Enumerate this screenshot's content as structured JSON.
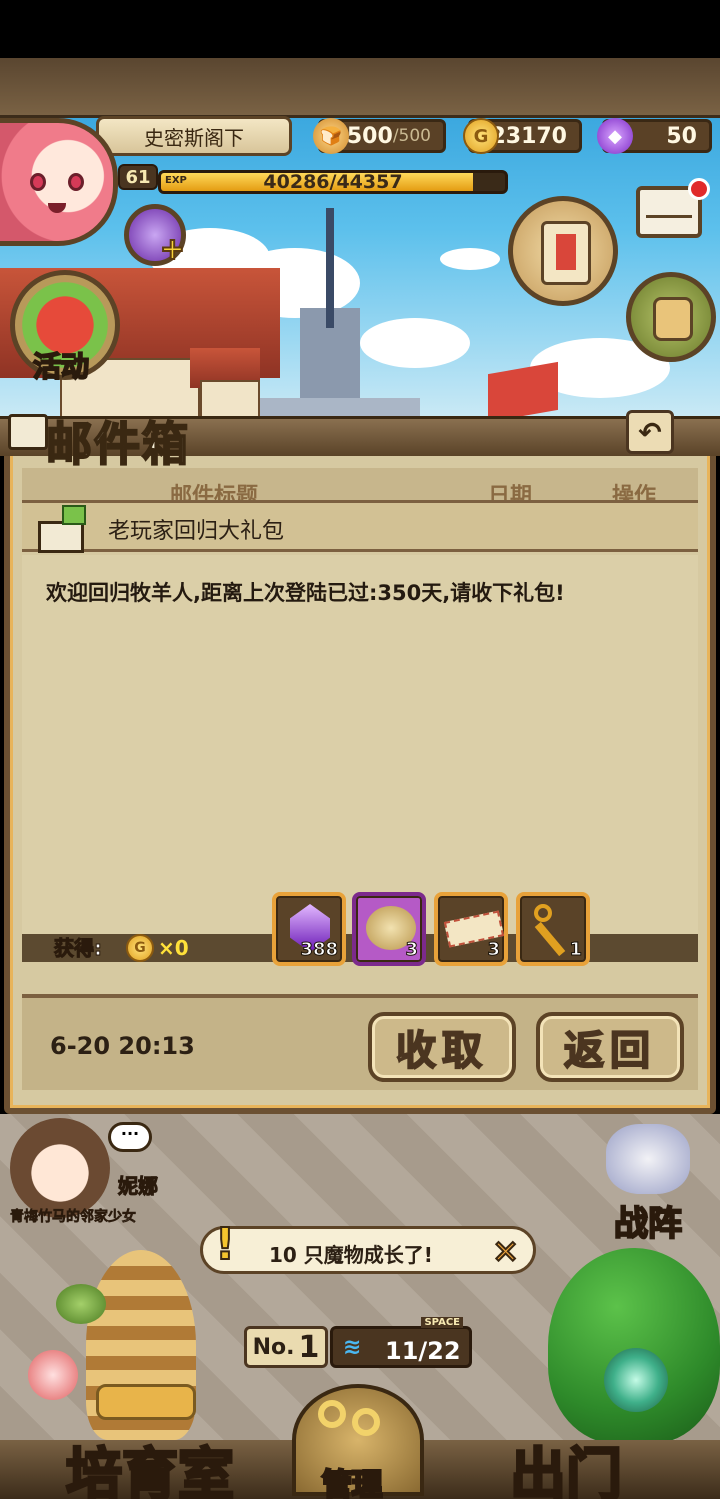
{
  "header": {
    "player_name": "史密斯阁下",
    "level": "61",
    "exp_label": "EXP",
    "exp_text": "40286/44357",
    "exp_fraction": 0.908,
    "stamina": {
      "current": "500",
      "max": "/500"
    },
    "gold": "23170",
    "gems": "50",
    "gold_icon_letter": "G"
  },
  "side_buttons": {
    "event_label": "活动"
  },
  "panel": {
    "title": "邮件箱",
    "back_symbol": "↶",
    "columns": {
      "title": "邮件标题",
      "date": "日期",
      "action": "操作"
    },
    "mail": {
      "subject": "老玩家回归大礼包",
      "body": "欢迎回归牧羊人,距离上次登陆已过:350天,请收下礼包!",
      "reward_label": "获得:",
      "gold_amount": "×0",
      "items": [
        {
          "icon": "purple-gem-icon",
          "count": "388"
        },
        {
          "icon": "treasure-bag-icon",
          "count": "3"
        },
        {
          "icon": "ticket-icon",
          "count": "3"
        },
        {
          "icon": "golden-key-icon",
          "count": "1"
        }
      ],
      "date": "6-20 20:13"
    },
    "buttons": {
      "collect": "收取",
      "back": "返回"
    }
  },
  "bottom": {
    "npc": {
      "name": "妮娜",
      "desc": "青梅竹马的邻家少女"
    },
    "notice": {
      "text": "10 只魔物成长了!",
      "bang": "!",
      "close": "✕"
    },
    "space": {
      "no_label": "No.",
      "no_value": "1",
      "value": "11/22",
      "label": "SPACE"
    },
    "formation_label": "战阵",
    "nav": {
      "nursery": "培育室",
      "manage": "管理",
      "go_out": "出门"
    }
  },
  "colors": {
    "panel_bg": "#d6c9a1",
    "frame_brown": "#6b5032",
    "accent_gold": "#e8a23a",
    "exp_fill": "#e49c12"
  }
}
